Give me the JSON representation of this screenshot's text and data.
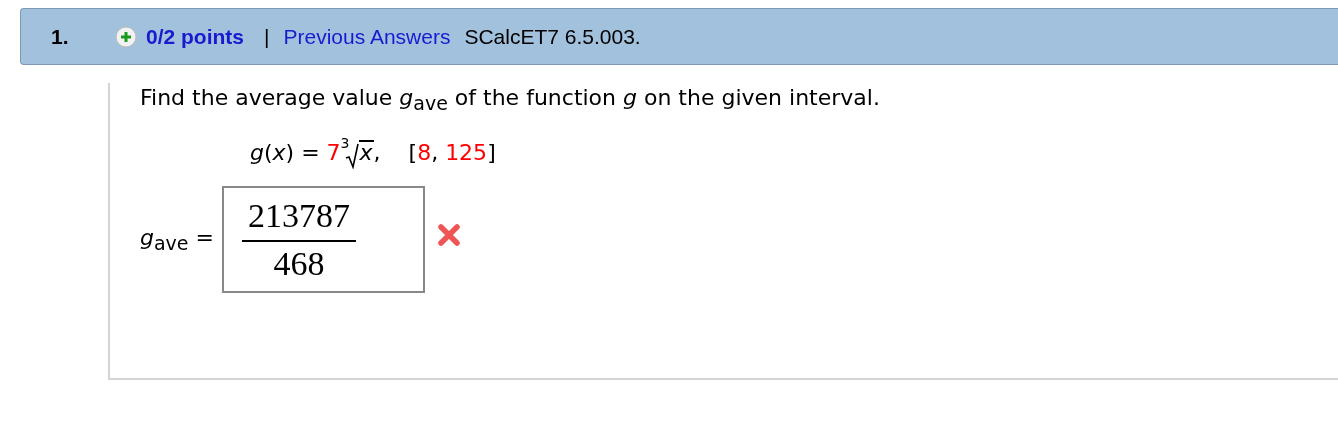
{
  "question": {
    "number": "1.",
    "points": "0/2 points",
    "separator": "|",
    "link": "Previous Answers",
    "source": "SCalcET7 6.5.003."
  },
  "prompt": "Find the average value *g*$_{ave}$ of the function *g* on the given interval.",
  "formula": [
    {
      "kind": "text",
      "text": "*g*(*x*) = "
    },
    {
      "kind": "param",
      "text": "7"
    },
    {
      "kind": "root",
      "index": "3",
      "radicand": "x"
    },
    {
      "kind": "text",
      "text": ",    ["
    },
    {
      "kind": "param",
      "text": "8"
    },
    {
      "kind": "text",
      "text": ", "
    },
    {
      "kind": "param",
      "text": "125"
    },
    {
      "kind": "text",
      "text": "]"
    }
  ],
  "answer": {
    "label": "*g*$_{ave}$ =",
    "numerator": "213787",
    "denominator": "468",
    "correct": false
  }
}
